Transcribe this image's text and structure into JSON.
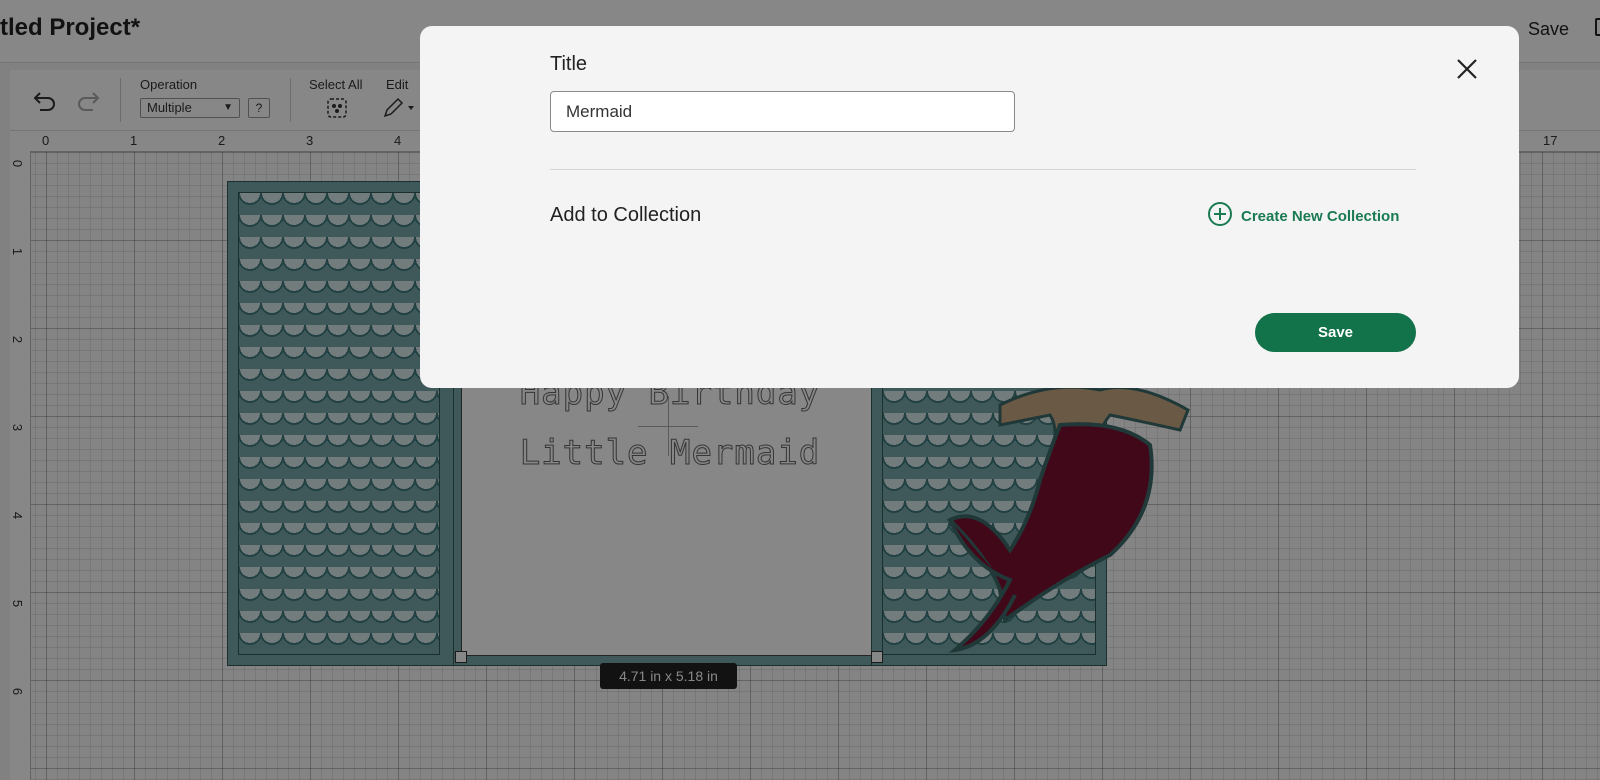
{
  "header": {
    "project_title": "tled Project*",
    "save_label": "Save"
  },
  "toolbar": {
    "operation_label": "Operation",
    "operation_value": "Multiple",
    "help_label": "?",
    "select_all_label": "Select All",
    "edit_label": "Edit"
  },
  "ruler": {
    "top": [
      "0",
      "1",
      "2",
      "3",
      "4",
      "17"
    ],
    "left": [
      "0",
      "1",
      "2",
      "3",
      "4",
      "5",
      "6"
    ]
  },
  "card": {
    "line1": "Happy Birthday",
    "line2": "Little Mermaid",
    "dimensions": "4.71  in x 5.18  in"
  },
  "modal": {
    "title_label": "Title",
    "title_value": "Mermaid",
    "collection_label": "Add to Collection",
    "create_collection_label": "Create New Collection",
    "save_label": "Save"
  },
  "colors": {
    "accent": "#12724a",
    "accent_text": "#1a7a52",
    "panel": "#78a9aa",
    "tail": "#7c1030"
  }
}
